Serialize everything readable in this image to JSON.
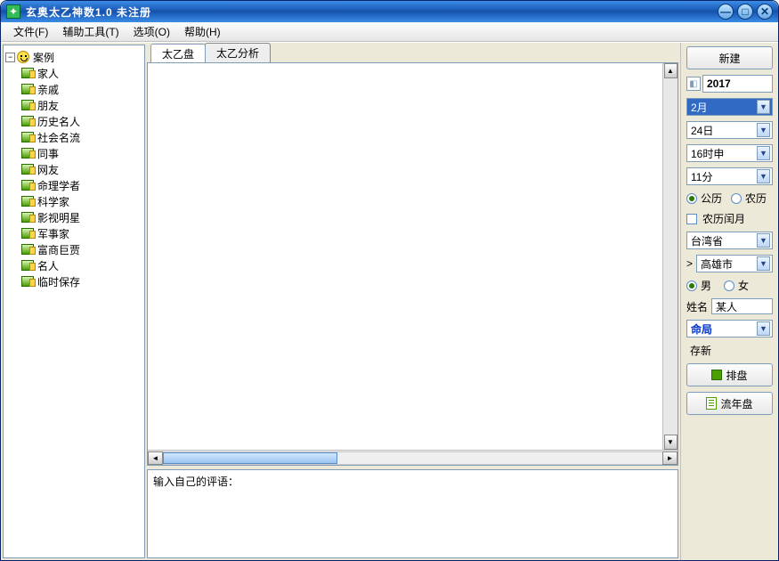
{
  "titlebar": {
    "title": "玄奥太乙神数1.0 未注册"
  },
  "menu": {
    "file": "文件(F)",
    "tools": "辅助工具(T)",
    "options": "选项(O)",
    "help": "帮助(H)"
  },
  "tree": {
    "root": "案例",
    "items": [
      "家人",
      "亲戚",
      "朋友",
      "历史名人",
      "社会名流",
      "同事",
      "网友",
      "命理学者",
      "科学家",
      "影视明星",
      "军事家",
      "富商巨贾",
      "名人",
      "临时保存"
    ]
  },
  "tabs": {
    "t1": "太乙盘",
    "t2": "太乙分析"
  },
  "comment": {
    "label": "输入自己的评语："
  },
  "right": {
    "new_btn": "新建",
    "year": "2017",
    "month": "2月",
    "day": "24日",
    "hour": "16时申",
    "minute": "11分",
    "cal_solar": "公历",
    "cal_lunar": "农历",
    "lunar_leap": "农历闰月",
    "province": "台湾省",
    "city": "高雄市",
    "gender_m": "男",
    "gender_f": "女",
    "name_label": "姓名",
    "name_value": "某人",
    "chart_type": "命局",
    "save_new": "存新",
    "paipan": "排盘",
    "liunian": "流年盘"
  }
}
